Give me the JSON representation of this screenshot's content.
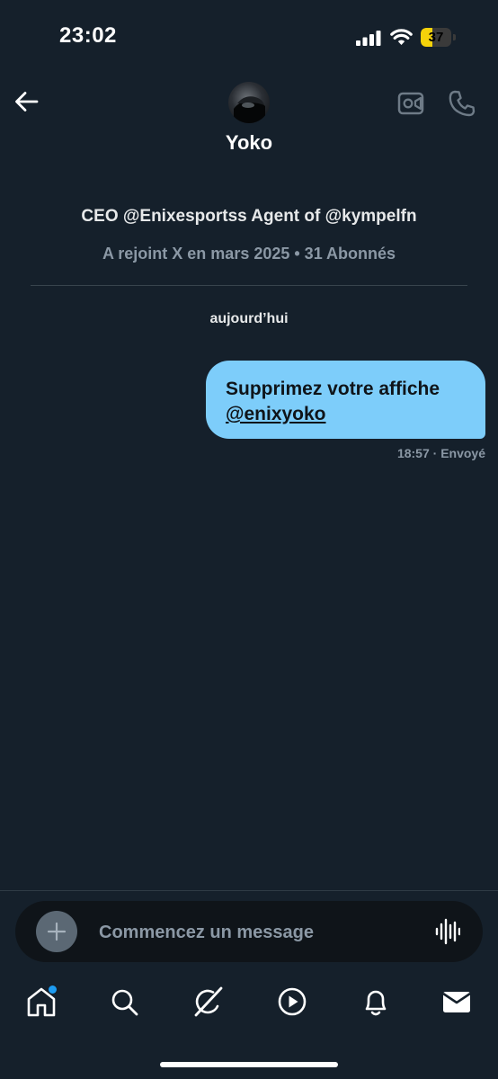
{
  "status_bar": {
    "time": "23:02",
    "battery_level": "37",
    "battery_fraction": 0.37,
    "battery_color": "#f5d20a"
  },
  "header": {
    "contact_name": "Yoko",
    "back_icon": "arrow-left-icon",
    "video_icon": "video-camera-icon",
    "phone_icon": "phone-icon"
  },
  "profile": {
    "bio": "CEO @Enixesportss Agent of @kympelfn",
    "meta": "A rejoint X en mars 2025 • 31 Abonnés"
  },
  "conversation": {
    "date_label": "aujourd’hui",
    "messages": [
      {
        "text": "Supprimez votre affiche",
        "mention": "@enixyoko",
        "time": "18:57",
        "status": "· Envoyé",
        "bubble_color": "#7dcdfa"
      }
    ]
  },
  "composer": {
    "placeholder": "Commencez un message",
    "value": "",
    "add_icon": "plus-icon",
    "voice_icon": "audio-waveform-icon"
  },
  "tab_bar": {
    "items": [
      {
        "name": "home",
        "icon": "home-icon",
        "active": true,
        "badge": true
      },
      {
        "name": "search",
        "icon": "search-icon"
      },
      {
        "name": "grok",
        "icon": "grok-icon"
      },
      {
        "name": "videos",
        "icon": "play-circle-icon"
      },
      {
        "name": "notifications",
        "icon": "bell-icon"
      },
      {
        "name": "messages",
        "icon": "envelope-icon",
        "active": true
      }
    ]
  },
  "colors": {
    "background": "#15202b",
    "accent": "#1d9bf0",
    "secondary_text": "#8b98a5"
  }
}
